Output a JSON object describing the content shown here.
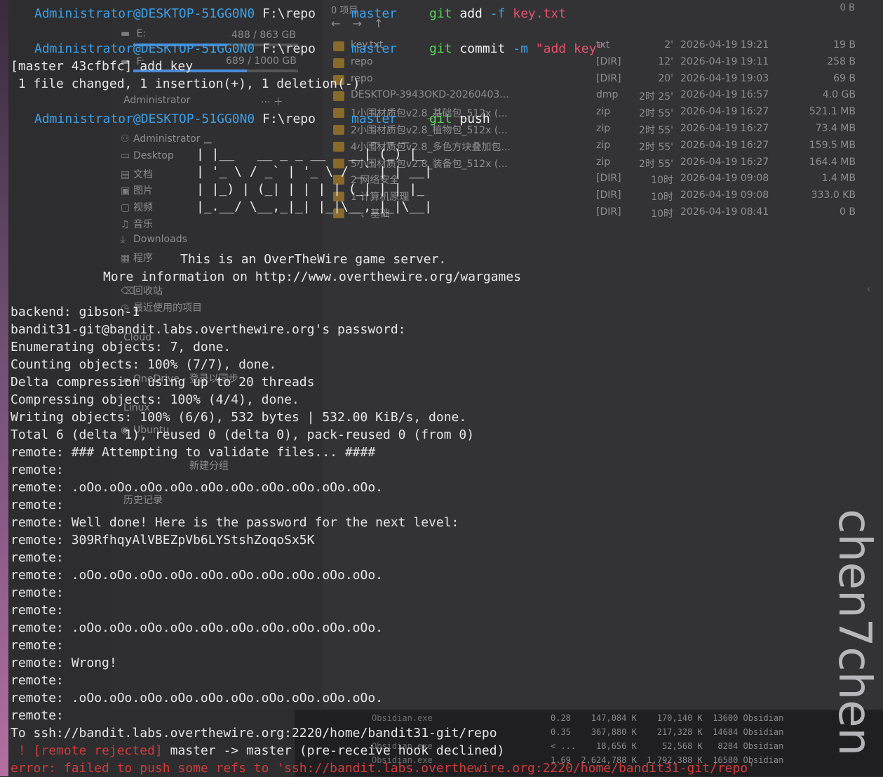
{
  "explorer": {
    "item_count": "0 项目",
    "zero_b": "0 B",
    "nav": "← → ↑",
    "drives": [
      {
        "label": "E:",
        "usage": "488 / 863 GB",
        "fill": 0.57
      },
      {
        "label": "F:",
        "usage": "689 / 1000 GB",
        "fill": 0.69
      }
    ],
    "sidebar": [
      {
        "icon": "person",
        "label": "Administrator"
      },
      {
        "icon": "desktop",
        "label": "Desktop"
      },
      {
        "icon": "document",
        "label": "文档"
      },
      {
        "icon": "picture",
        "label": "图片"
      },
      {
        "icon": "video",
        "label": "视频"
      },
      {
        "icon": "music",
        "label": "音乐"
      },
      {
        "icon": "download",
        "label": "Downloads"
      },
      {
        "icon": "apps",
        "label": "程序"
      },
      {
        "icon": "trash",
        "label": "回收站"
      },
      {
        "icon": "recent",
        "label": "最近使用的项目"
      },
      {
        "icon": "cloud",
        "label": "Cloud"
      },
      {
        "icon": "onedrive",
        "label": "OneDrive - 登录以同步"
      },
      {
        "icon": "linux",
        "label": "Linux"
      },
      {
        "icon": "ubuntu",
        "label": "Ubuntu"
      },
      {
        "icon": "group",
        "label": "新建分组"
      },
      {
        "icon": "history",
        "label": "历史记录"
      }
    ],
    "section_admin": "Administrator",
    "files": [
      {
        "name": "key.txt",
        "type": "txt",
        "age": "2'",
        "date": "2026-04-19  19:21",
        "size": "19 B"
      },
      {
        "name": "repo",
        "type": "[DIR]",
        "age": "12'",
        "date": "2026-04-19  19:11",
        "size": "258 B"
      },
      {
        "name": "repo",
        "type": "[DIR]",
        "age": "20'",
        "date": "2026-04-19  19:03",
        "size": "69 B"
      },
      {
        "name": "DESKTOP-3943OKD-20260403...",
        "type": "dmp",
        "age": "2时 25'",
        "date": "2026-04-19  16:57",
        "size": "4.0 GB"
      },
      {
        "name": "1小围材质包v2.8_基础包_512x (...",
        "type": "zip",
        "age": "2时 55'",
        "date": "2026-04-19  16:27",
        "size": "521.1 MB"
      },
      {
        "name": "2小围材质包v2.8_植物包_512x (...",
        "type": "zip",
        "age": "2时 55'",
        "date": "2026-04-19  16:27",
        "size": "73.4 MB"
      },
      {
        "name": "4小围材质包v2.8_多色方块叠加包...",
        "type": "zip",
        "age": "2时 55'",
        "date": "2026-04-19  16:27",
        "size": "159.5 MB"
      },
      {
        "name": "5小围材质包v2.8_装备包_512x (...",
        "type": "zip",
        "age": "2时 55'",
        "date": "2026-04-19  16:27",
        "size": "164.4 MB"
      },
      {
        "name": "2 网络安全",
        "type": "[DIR]",
        "age": "10时",
        "date": "2026-04-19  09:08",
        "size": "1.4 MB"
      },
      {
        "name": "1 计算机原理",
        "type": "[DIR]",
        "age": "10时",
        "date": "2026-04-19  09:08",
        "size": "333.0 KB"
      },
      {
        "name": "一、基础",
        "type": "[DIR]",
        "age": "10时",
        "date": "2026-04-19  08:41",
        "size": "0 B"
      }
    ]
  },
  "taskbar": {
    "processes": [
      "Obsidian.exe",
      "Obsidian.exe",
      "Obsidian.exe"
    ],
    "tm_rows": [
      "0.28    147,084 K    170,140 K  13600 Obsidian",
      "0.35    367,880 K    217,328 K  14684 Obsidian",
      "< ...    18,656 K     52,568 K   8284 Obsidian",
      "1.69  2,624,788 K  1,792,388 K  16580 Obsidian"
    ]
  },
  "watermark": "chen7chen",
  "terminal": {
    "prompts": [
      {
        "user": "Administrator@DESKTOP-51GG0N0",
        "path": "F:\\repo",
        "branch": "master",
        "git": "git",
        "cmd": "add",
        "flag": "-f",
        "arg": "key.txt"
      },
      {
        "user": "Administrator@DESKTOP-51GG0N0",
        "path": "F:\\repo",
        "branch": "master",
        "git": "git",
        "cmd": "commit",
        "flag": "-m",
        "arg": "\"add key\""
      },
      {
        "user": "Administrator@DESKTOP-51GG0N0",
        "path": "F:\\repo",
        "branch": "master",
        "git": "git",
        "cmd": "push",
        "flag": "",
        "arg": ""
      }
    ],
    "commit_line1": "[master 43cfbfc] add key",
    "commit_line2": " 1 file changed, 1 insertion(+), 1 deletion(-)",
    "ascii_art": [
      " _                     _ _ _   ",
      "| |__   __ _ _ __   __| (_) |_ ",
      "| '_ \\ / _` | '_ \\ / _` | | __|",
      "| |_) | (_| | | | | (_| | | |_ ",
      "|_.__/ \\__,_|_| |_|\\__,_|_|\\__|"
    ],
    "banner1": "This is an OverTheWire game server.",
    "banner2": "More information on http://www.overthewire.org/wargames",
    "output": [
      "backend: gibson-1",
      "bandit31-git@bandit.labs.overthewire.org's password:",
      "Enumerating objects: 7, done.",
      "Counting objects: 100% (7/7), done.",
      "Delta compression using up to 20 threads",
      "Compressing objects: 100% (4/4), done.",
      "Writing objects: 100% (6/6), 532 bytes | 532.00 KiB/s, done.",
      "Total 6 (delta 1), reused 0 (delta 0), pack-reused 0 (from 0)",
      "remote: ### Attempting to validate files... ####",
      "remote:",
      "remote: .oOo.oOo.oOo.oOo.oOo.oOo.oOo.oOo.oOo.oOo.",
      "remote:",
      "remote: Well done! Here is the password for the next level:",
      "remote: 309RfhqyAlVBEZpVb6LYStshZoqoSx5K",
      "remote:",
      "remote: .oOo.oOo.oOo.oOo.oOo.oOo.oOo.oOo.oOo.oOo.",
      "remote:",
      "remote:",
      "remote: .oOo.oOo.oOo.oOo.oOo.oOo.oOo.oOo.oOo.oOo.",
      "remote:",
      "remote: Wrong!",
      "remote:",
      "remote: .oOo.oOo.oOo.oOo.oOo.oOo.oOo.oOo.oOo.oOo.",
      "remote:",
      "To ssh://bandit.labs.overthewire.org:2220/home/bandit31-git/repo"
    ],
    "rejected_prefix": " ! [remote rejected]",
    "rejected_rest": " master -> master (pre-receive hook declined)",
    "error_line": "error: failed to push some refs to 'ssh://bandit.labs.overthewire.org:2220/home/bandit31-git/repo'"
  },
  "colors": {
    "prompt_user": "#3aa0e8",
    "git_cmd": "#5ad25a",
    "string_arg": "#e8506a",
    "error": "#d13b3b"
  }
}
